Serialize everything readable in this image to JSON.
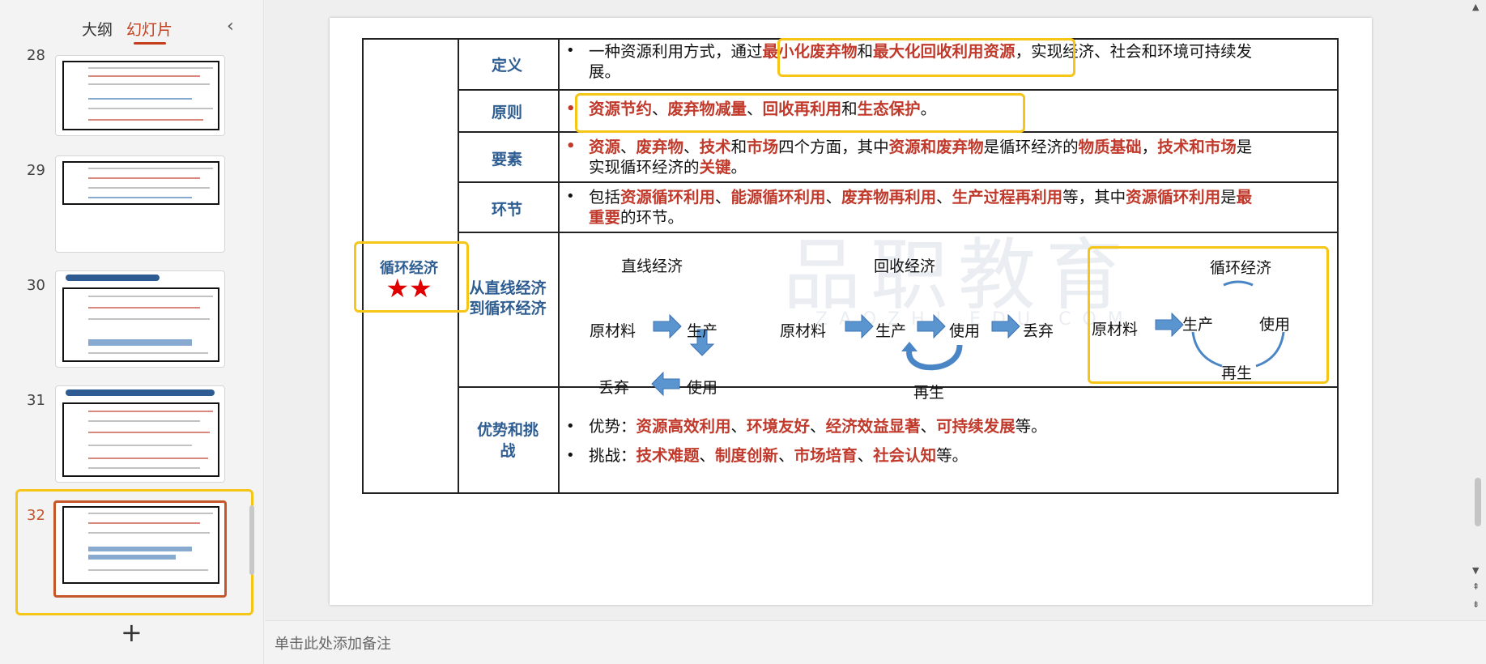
{
  "left_panel": {
    "tab_outline": "大纲",
    "tab_slides": "幻灯片",
    "collapse_icon": "‹",
    "add_slide_icon": "+",
    "thumbs": [
      {
        "number": "28"
      },
      {
        "number": "29"
      },
      {
        "number": "30"
      },
      {
        "number": "31"
      },
      {
        "number": "32"
      }
    ]
  },
  "slide": {
    "main_label": "循环经济",
    "stars": "★★",
    "rows": {
      "definition": {
        "label": "定义",
        "bullet": "•",
        "pre": "一种资源利用方式，通过",
        "hl1": "最小化废弃物",
        "mid": "和",
        "hl2": "最大化回收利用资源",
        "post": "，实现经济、社会和环境可持续发",
        "line2": "展。"
      },
      "principle": {
        "label": "原则",
        "bullet": "•",
        "t1": "资源节约",
        "s1": "、",
        "t2": "废弃物减量",
        "s2": "、",
        "t3": "回收再利用",
        "s3": "和",
        "t4": "生态保护",
        "end": "。"
      },
      "elements": {
        "label": "要素",
        "bullet": "•",
        "t1": "资源",
        "s1": "、",
        "t2": "废弃物",
        "s2": "、",
        "t3": "技术",
        "s3": "和",
        "t4": "市场",
        "s4": "四个方面，其中",
        "t5": "资源和废弃物",
        "s5": "是循环经济的",
        "t6": "物质基础",
        "s6": "，",
        "t7": "技术和市场",
        "s7": "是",
        "line2_pre": "实现循环经济的",
        "t8": "关键",
        "end": "。"
      },
      "links": {
        "label": "环节",
        "bullet": "•",
        "pre": "包括",
        "t1": "资源循环利用",
        "s1": "、",
        "t2": "能源循环利用",
        "s2": "、",
        "t3": "废弃物再利用",
        "s3": "、",
        "t4": "生产过程再利用",
        "s4": "等，其中",
        "t5": "资源循环利用",
        "s5": "是",
        "t6": "最",
        "line2_t": "重要",
        "line2_end": "的环节。"
      },
      "transition": {
        "label": "从直线经济到循环经济",
        "linear": {
          "title": "直线经济",
          "raw": "原材料",
          "produce": "生产",
          "use": "使用",
          "discard": "丢弃"
        },
        "recycle": {
          "title": "回收经济",
          "raw": "原材料",
          "produce": "生产",
          "use": "使用",
          "discard": "丢弃",
          "regen": "再生"
        },
        "circular": {
          "title": "循环经济",
          "raw": "原材料",
          "produce": "生产",
          "use": "使用",
          "regen": "再生"
        }
      },
      "advantages": {
        "label": "优势和挑战",
        "bullet": "•",
        "adv_pre": "优势：",
        "a1": "资源高效利用",
        "a_s1": "、",
        "a2": "环境友好",
        "a_s2": "、",
        "a3": "经济效益显著",
        "a_s3": "、",
        "a4": "可持续发展",
        "a_end": "等。",
        "ch_pre": "挑战：",
        "c1": "技术难题",
        "c_s1": "、",
        "c2": "制度创新",
        "c_s2": "、",
        "c3": "市场培育",
        "c_s3": "、",
        "c4": "社会认知",
        "c_end": "等。"
      }
    },
    "watermark": "品职教育",
    "watermark_sub": "ZAOZHI EDU.COM"
  },
  "notes_placeholder": "单击此处添加备注",
  "colors": {
    "accent": "#c43e1c",
    "highlight": "#f5c518",
    "label_blue": "#2e5d92",
    "keyword_red": "#c0392b",
    "arrow_blue": "#4a86c5"
  }
}
